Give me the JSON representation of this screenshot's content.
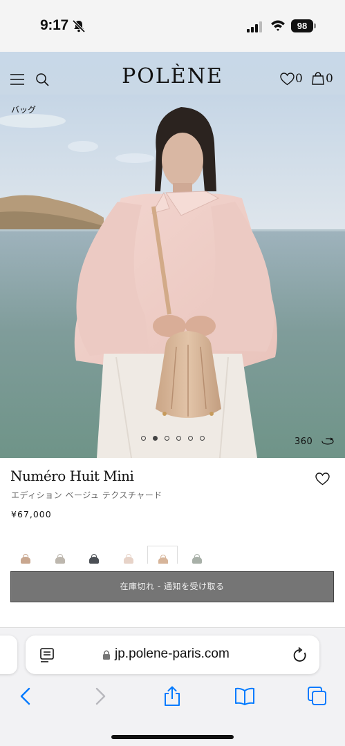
{
  "status_bar": {
    "time": "9:17",
    "battery": "98"
  },
  "header": {
    "brand": "POLÈNE",
    "wishlist_count": "0",
    "cart_count": "0"
  },
  "hero": {
    "category": "バッグ",
    "view360": "360",
    "slide_count": 6,
    "active_slide": 2
  },
  "product": {
    "name": "Numéro Huit Mini",
    "edition": "エディション ベージュ テクスチャード",
    "price": "¥67,000",
    "swatch_colors": [
      "#c9a78f",
      "#bdb7ae",
      "#4b4f55",
      "#e7d3c8",
      "#d7b59a",
      "#a8b0a8"
    ],
    "selected_swatch": 4
  },
  "notify_button": {
    "label": "在庫切れ - 通知を受け取る"
  },
  "browser": {
    "url": "jp.polene-paris.com"
  },
  "colors": {
    "accent": "#007aff",
    "button_bg": "#757575"
  }
}
